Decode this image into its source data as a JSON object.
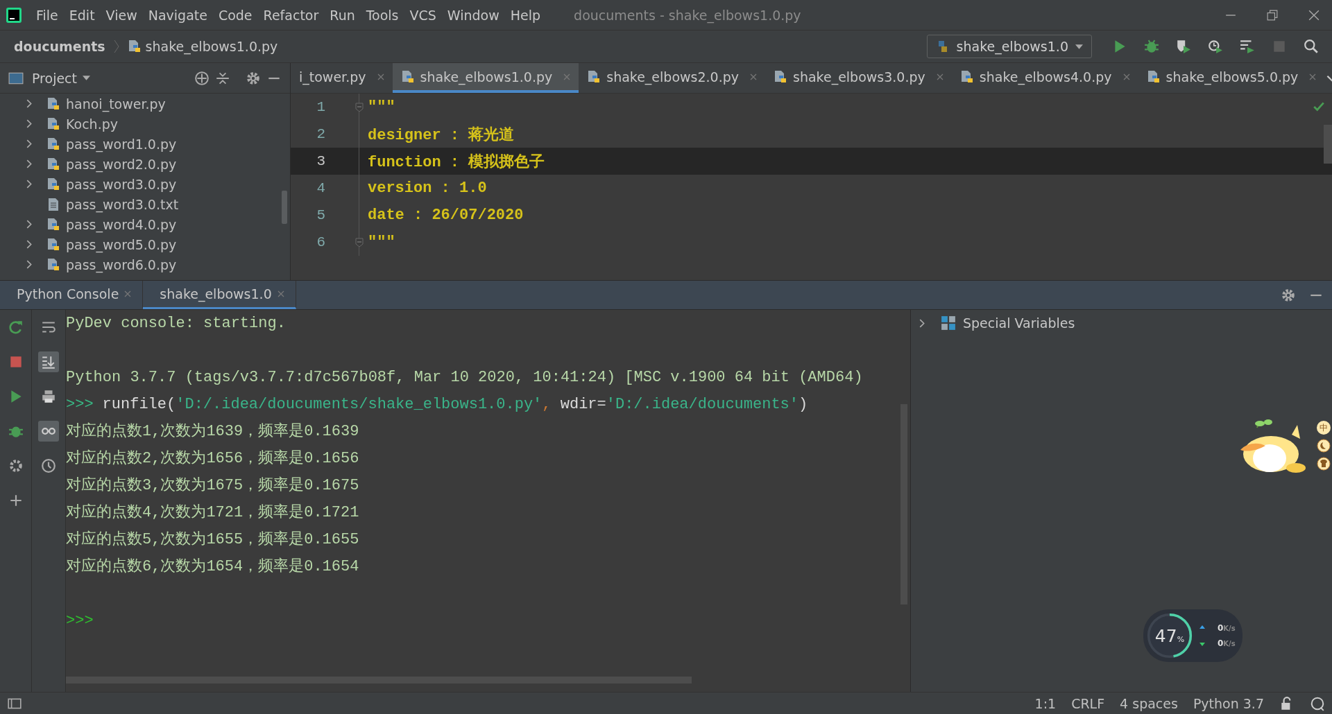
{
  "window": {
    "title": "doucuments - shake_elbows1.0.py"
  },
  "menu": [
    "File",
    "Edit",
    "View",
    "Navigate",
    "Code",
    "Refactor",
    "Run",
    "Tools",
    "VCS",
    "Window",
    "Help"
  ],
  "breadcrumb": [
    {
      "label": "doucuments",
      "kind": "folder"
    },
    {
      "label": "shake_elbows1.0.py",
      "kind": "file"
    }
  ],
  "run_config": {
    "label": "shake_elbows1.0"
  },
  "project": {
    "title": "Project",
    "items": [
      {
        "name": "hanoi_tower.py",
        "kind": "py",
        "expandable": true
      },
      {
        "name": "Koch.py",
        "kind": "py",
        "expandable": true
      },
      {
        "name": "pass_word1.0.py",
        "kind": "py",
        "expandable": true
      },
      {
        "name": "pass_word2.0.py",
        "kind": "py",
        "expandable": true
      },
      {
        "name": "pass_word3.0.py",
        "kind": "py",
        "expandable": true
      },
      {
        "name": "pass_word3.0.txt",
        "kind": "txt",
        "expandable": false
      },
      {
        "name": "pass_word4.0.py",
        "kind": "py",
        "expandable": true
      },
      {
        "name": "pass_word5.0.py",
        "kind": "py",
        "expandable": true
      },
      {
        "name": "pass_word6.0.py",
        "kind": "py",
        "expandable": true
      }
    ]
  },
  "editor_tabs": [
    {
      "label": "i_tower.py",
      "selected": false,
      "icon": false
    },
    {
      "label": "shake_elbows1.0.py",
      "selected": true,
      "icon": true
    },
    {
      "label": "shake_elbows2.0.py",
      "selected": false,
      "icon": true
    },
    {
      "label": "shake_elbows3.0.py",
      "selected": false,
      "icon": true
    },
    {
      "label": "shake_elbows4.0.py",
      "selected": false,
      "icon": true
    },
    {
      "label": "shake_elbows5.0.py",
      "selected": false,
      "icon": true
    }
  ],
  "editor": {
    "lines": [
      {
        "number": "1",
        "text": "\"\"\"",
        "current": false,
        "fold": true
      },
      {
        "number": "2",
        "text": "designer : 蒋光道",
        "current": false,
        "fold": false
      },
      {
        "number": "3",
        "text": "function : 模拟掷色子",
        "current": true,
        "fold": false
      },
      {
        "number": "4",
        "text": "version : 1.0",
        "current": false,
        "fold": false
      },
      {
        "number": "5",
        "text": "date : 26/07/2020",
        "current": false,
        "fold": false
      },
      {
        "number": "6",
        "text": "\"\"\"",
        "current": false,
        "fold": true
      }
    ]
  },
  "console_tabs": [
    {
      "label": "Python Console",
      "selected": false
    },
    {
      "label": "shake_elbows1.0",
      "selected": true
    }
  ],
  "console": {
    "lines": [
      {
        "kind": "info",
        "text": "PyDev console: starting."
      },
      {
        "kind": "blank"
      },
      {
        "kind": "info",
        "text": "Python 3.7.7 (tags/v3.7.7:d7c567b08f, Mar 10 2020, 10:41:24) [MSC v.1900 64 bit (AMD64)"
      },
      {
        "kind": "command",
        "prompt": ">>>",
        "segments": [
          {
            "text": "runfile(",
            "kind": "plain"
          },
          {
            "text": "'D:/.idea/doucuments/shake_elbows1.0.py'",
            "kind": "string"
          },
          {
            "text": ",",
            "kind": "punct"
          },
          {
            "text": " wdir=",
            "kind": "plain"
          },
          {
            "text": "'D:/.idea/doucuments'",
            "kind": "string"
          },
          {
            "text": ")",
            "kind": "plain"
          }
        ]
      },
      {
        "kind": "output",
        "text": "对应的点数1,次数为1639，频率是0.1639"
      },
      {
        "kind": "output",
        "text": "对应的点数2,次数为1656，频率是0.1656"
      },
      {
        "kind": "output",
        "text": "对应的点数3,次数为1675，频率是0.1675"
      },
      {
        "kind": "output",
        "text": "对应的点数4,次数为1721，频率是0.1721"
      },
      {
        "kind": "output",
        "text": "对应的点数5,次数为1655，频率是0.1655"
      },
      {
        "kind": "output",
        "text": "对应的点数6,次数为1654，频率是0.1654"
      },
      {
        "kind": "blank"
      },
      {
        "kind": "prompt",
        "text": ">>>"
      }
    ]
  },
  "variables": {
    "items": [
      {
        "label": "Special Variables",
        "expanded": false
      }
    ]
  },
  "speed_widget": {
    "percent": "47",
    "percent_unit": "%",
    "upload": "0",
    "upload_unit": "K/s",
    "download": "0",
    "download_unit": "K/s",
    "level": 0.47
  },
  "ime": {
    "mode": "中"
  },
  "status_bar": {
    "position": "1:1",
    "line_ending": "CRLF",
    "indent": "4 spaces",
    "interpreter": "Python 3.7"
  }
}
